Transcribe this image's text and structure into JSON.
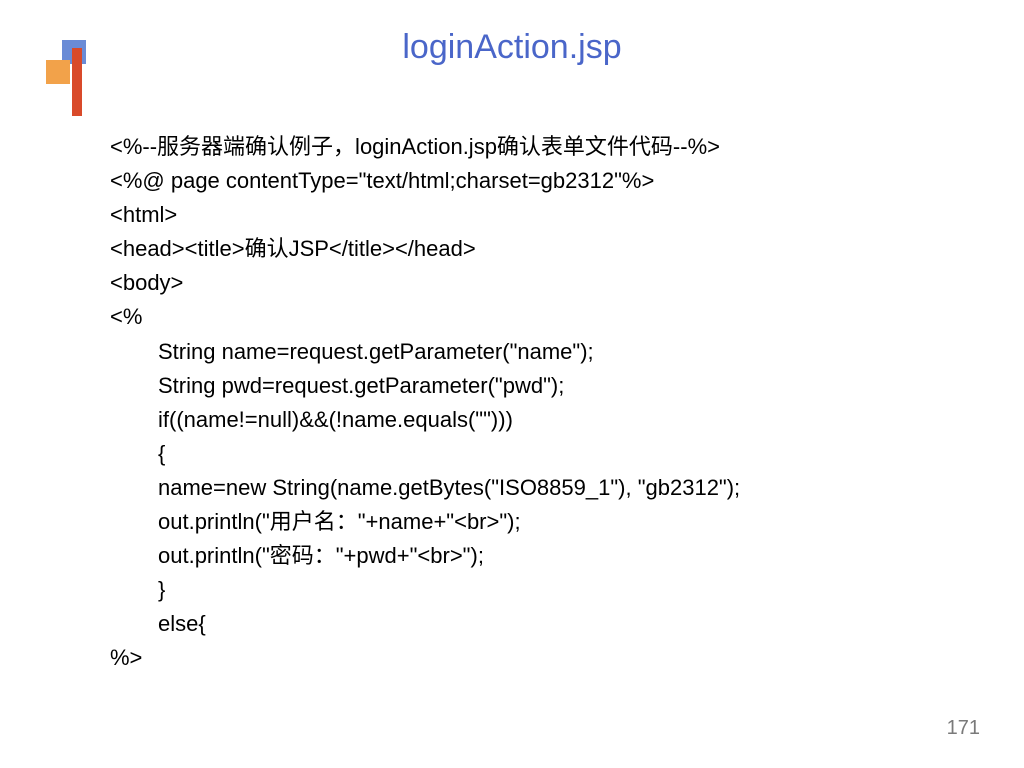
{
  "title": "loginAction.jsp",
  "page_number": "171",
  "code": {
    "l0": "<%--服务器端确认例子，loginAction.jsp确认表单文件代码--%>",
    "l1": "<%@ page contentType=\"text/html;charset=gb2312\"%>",
    "l2": "<html>",
    "l3": "<head><title>确认JSP</title></head>",
    "l4": "<body>",
    "l5": "<%",
    "l6": "String name=request.getParameter(\"name\");",
    "l7": "String pwd=request.getParameter(\"pwd\");",
    "l8": "if((name!=null)&&(!name.equals(\"\")))",
    "l9": "{",
    "l10": "name=new String(name.getBytes(\"ISO8859_1\"), \"gb2312\");",
    "l11": "out.println(\"用户名：\"+name+\"<br>\");",
    "l12": "out.println(\"密码：\"+pwd+\"<br>\");",
    "l13": "}",
    "l14": "else{",
    "l15": "%>"
  }
}
